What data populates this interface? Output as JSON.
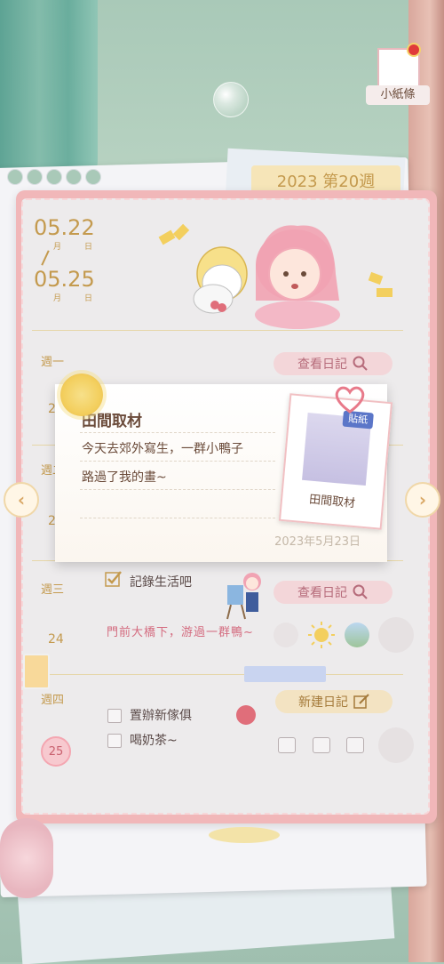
{
  "note": {
    "label": "小紙條"
  },
  "week_tab": "2023 第20週",
  "date_range": {
    "start": "05.22",
    "end": "05.25",
    "month_label": "月",
    "day_label": "日"
  },
  "days": [
    {
      "name": "週一",
      "num": "22"
    },
    {
      "name": "週二",
      "num": "23"
    },
    {
      "name": "週三",
      "num": "24"
    },
    {
      "name": "週四",
      "num": "25"
    }
  ],
  "buttons": {
    "view_diary": "查看日記",
    "new_diary": "新建日記"
  },
  "popup": {
    "title": "田間取材",
    "line1": "今天去郊外寫生，一群小鴨子",
    "line2": "路過了我的畫~",
    "date": "2023年5月23日",
    "sticker_badge": "貼紙",
    "sticker_label": "田間取材"
  },
  "wednesday": {
    "todo": "記錄生活吧",
    "desc": "門前大橋下，游過一群鴨~"
  },
  "thursday": {
    "todo1": "置辦新傢俱",
    "todo2": "喝奶茶~"
  },
  "colors": {
    "accent": "#c49a4e",
    "pink": "#f1b7b9",
    "pill_pink": "#f3d6d9",
    "pill_yellow": "#f3e3c2"
  }
}
